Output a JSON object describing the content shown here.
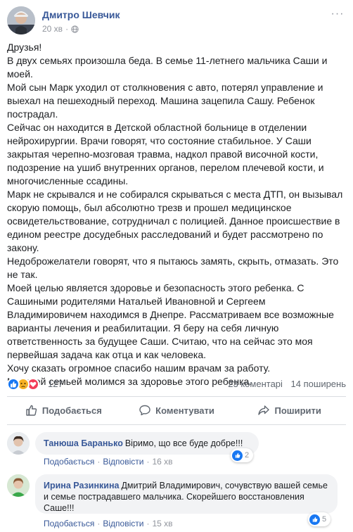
{
  "post": {
    "author": "Дмитро Шевчик",
    "time": "20 хв",
    "body": [
      "Друзья!",
      "В двух семьях произошла беда. В семье 11-летнего мальчика Саши и моей.",
      "Мой сын Марк уходил от столкновения с авто, потерял управление и выехал на пешеходный переход. Машина зацепила Сашу. Ребенок пострадал.",
      "Сейчас он находится в Детской областной больнице в отделении нейрохирургии. Врачи говорят, что состояние стабильное. У Саши закрытая черепно-мозговая травма, надкол правой височной кости, подозрение на ушиб внутренних органов, перелом плечевой кости, и многочисленные ссадины.",
      "Марк не скрывался и не собирался скрываться с места ДТП, он вызывал скорую помощь, был абсолютно трезв и прошел медицинское освидетельствование, сотрудничал с полицией. Данное происшествие в едином реестре досудебных расследований и будет рассмотрено по закону.",
      "Недоброжелатели говорят, что я пытаюсь замять, скрыть, отмазать. Это не так.",
      "Моей целью является здоровье и безопасность этого ребенка. С Сашиными родителями Натальей Ивановной и Сергеем Владимировичем находимся в Днепре. Рассматриваем все возможные варианты лечения и реабилитации. Я беру на себя личную ответственность за будущее Саши. Считаю, что на сейчас это моя первейшая задача как отца и как человека.",
      "Хочу сказать огромное спасибо нашим врачам за работу.",
      "Мы всей семьей молимся за здоровье этого ребенка."
    ],
    "reactions_count": "127",
    "comments_count": "23 коментарі",
    "shares_count": "14 поширень",
    "reaction_icons": [
      "like-icon",
      "sad-icon",
      "love-icon"
    ]
  },
  "actions": {
    "like": "Подобається",
    "comment": "Коментувати",
    "share": "Поширити"
  },
  "comments": [
    {
      "author": "Танюша Баранько",
      "text": "Віримо, що все буде добре!!!",
      "likes": "2",
      "like_label": "Подобається",
      "reply_label": "Відповісти",
      "time": "16 хв"
    },
    {
      "author": "Ирина Разинкина",
      "text": "Дмитрий Владимирович, сочувствую вашей семье и семье пострадавшего мальчика. Скорейшего восстановления Саше!!!",
      "likes": "5",
      "like_label": "Подобається",
      "reply_label": "Відповісти",
      "time": "15 хв"
    }
  ],
  "colors": {
    "link": "#385898",
    "like_blue": "#1877f2",
    "muted": "#90949c",
    "bubble_bg": "#f2f3f5"
  }
}
